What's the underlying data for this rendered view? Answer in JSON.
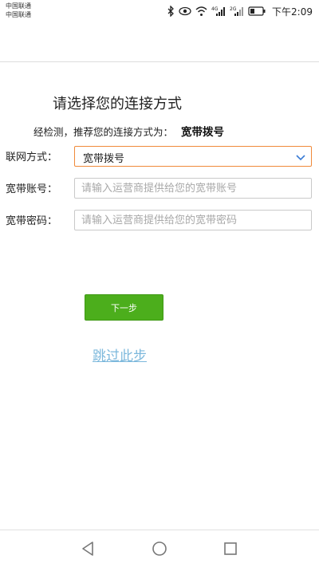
{
  "status_bar": {
    "carrier_1": "中国联通",
    "carrier_2": "中国联通",
    "network_1": "4G",
    "network_2": "2G",
    "time": "下午2:09",
    "icons": [
      "bluetooth-icon",
      "eye-icon",
      "wifi-icon",
      "signal-icon",
      "signal-icon",
      "battery-icon"
    ]
  },
  "page": {
    "title": "请选择您的连接方式",
    "detect_prefix": "经检测，推荐您的连接方式为：",
    "detect_value": "宽带拨号"
  },
  "form": {
    "connection_label": "联网方式：",
    "connection_value": "宽带拨号",
    "account_label": "宽带账号：",
    "account_placeholder": "请输入运营商提供给您的宽带账号",
    "account_value": "",
    "password_label": "宽带密码：",
    "password_placeholder": "请输入运营商提供给您的宽带密码",
    "password_value": ""
  },
  "actions": {
    "next_label": "下一步",
    "skip_label": "跳过此步"
  },
  "colors": {
    "accent_orange": "#f08a3a",
    "button_green": "#4cae1c",
    "link_blue": "#7cb8dc",
    "chevron_blue": "#3a7bd5"
  },
  "navigation": {
    "icons": [
      "back-icon",
      "home-icon",
      "recents-icon"
    ]
  }
}
